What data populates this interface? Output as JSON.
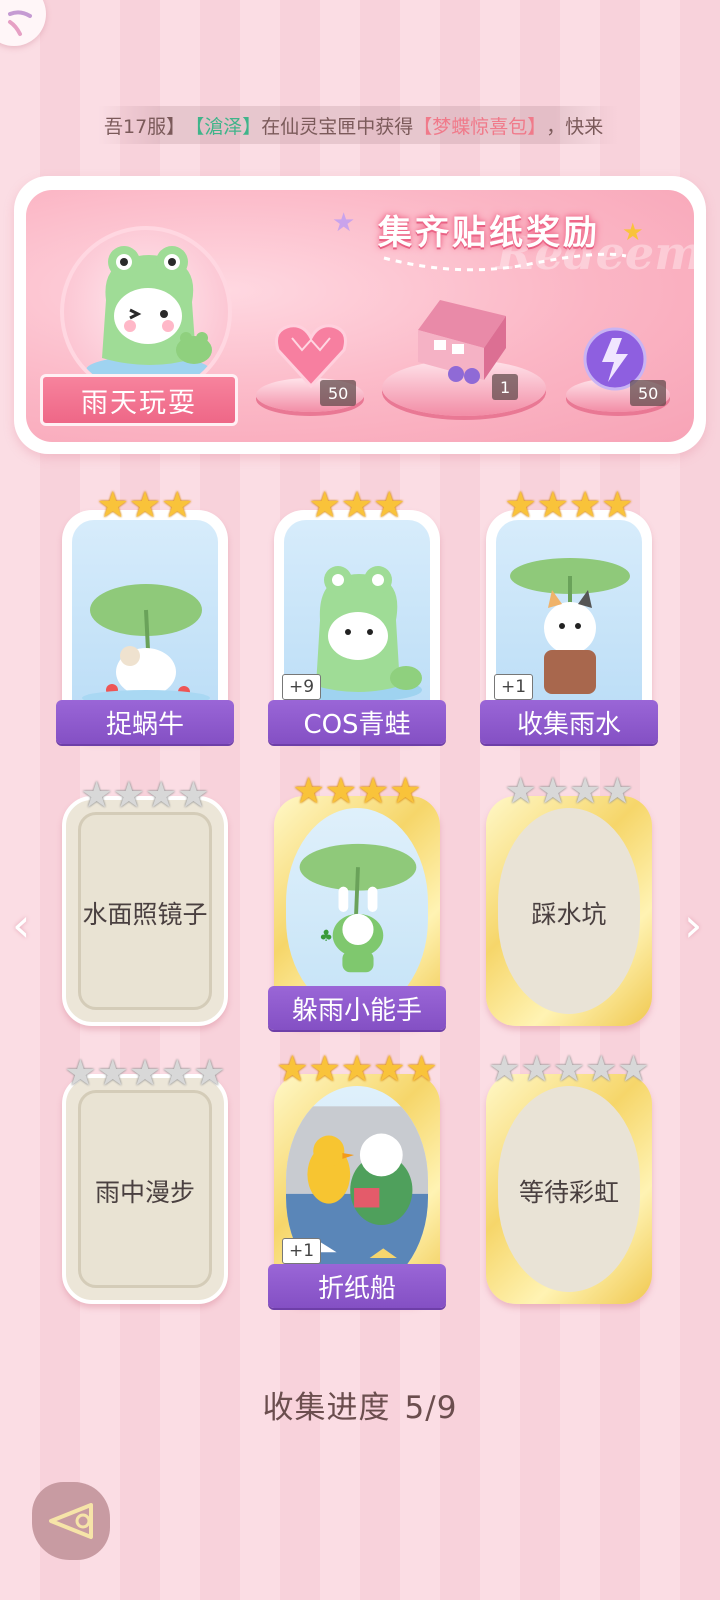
{
  "ticker": {
    "prefix": "吾17服】",
    "player": "【滄泽】",
    "middle": "在仙灵宝匣中获得",
    "item": "【梦蝶惊喜包】",
    "suffix": "，快来"
  },
  "reward": {
    "title": "集齐贴纸奖励",
    "watermark": "Redeem",
    "set_name": "雨天玩耍",
    "items": [
      {
        "icon": "pink-heart-gem-icon",
        "count": "50"
      },
      {
        "icon": "gift-box-icon",
        "count": "1"
      },
      {
        "icon": "purple-energy-orb-icon",
        "count": "50"
      }
    ]
  },
  "stickers": [
    {
      "name": "捉蜗牛",
      "stars": 3,
      "max": 3,
      "state": "collected",
      "extra": ""
    },
    {
      "name": "COS青蛙",
      "stars": 3,
      "max": 3,
      "state": "collected",
      "extra": "+9"
    },
    {
      "name": "收集雨水",
      "stars": 4,
      "max": 4,
      "state": "collected",
      "extra": "+1"
    },
    {
      "name": "水面照镜子",
      "stars": 0,
      "max": 4,
      "state": "locked",
      "extra": ""
    },
    {
      "name": "躲雨小能手",
      "stars": 4,
      "max": 4,
      "state": "collected-gold",
      "extra": ""
    },
    {
      "name": "踩水坑",
      "stars": 0,
      "max": 4,
      "state": "locked-gold",
      "extra": ""
    },
    {
      "name": "雨中漫步",
      "stars": 0,
      "max": 5,
      "state": "locked",
      "extra": ""
    },
    {
      "name": "折纸船",
      "stars": 5,
      "max": 5,
      "state": "collected-gold",
      "extra": "+1"
    },
    {
      "name": "等待彩虹",
      "stars": 0,
      "max": 5,
      "state": "locked-gold",
      "extra": ""
    }
  ],
  "progress": {
    "label": "收集进度",
    "value": "5/9"
  },
  "nav": {
    "prev": "‹",
    "next": "›"
  },
  "colors": {
    "accent": "#9a66d7",
    "pink": "#f7839d",
    "gold": "#f9c33a"
  }
}
